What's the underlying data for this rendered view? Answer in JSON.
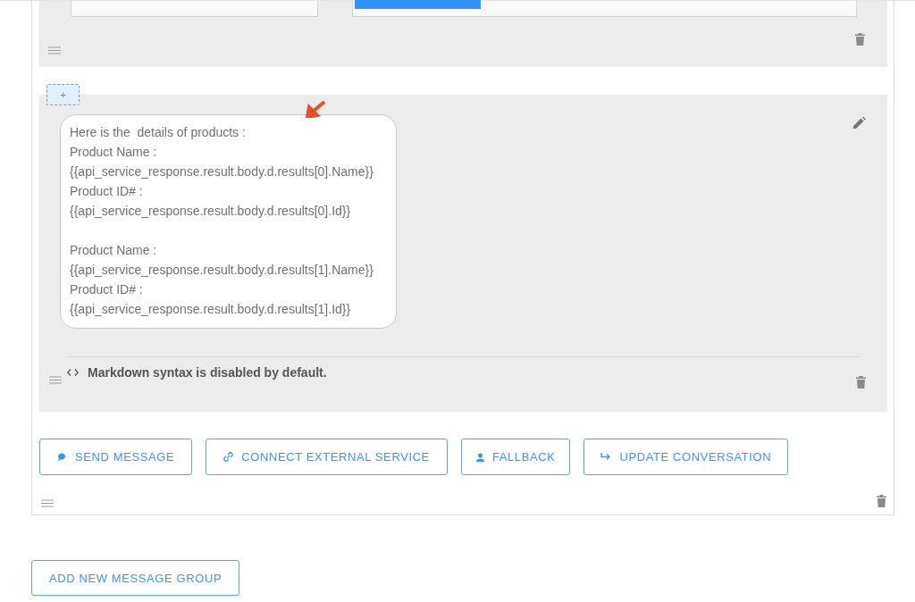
{
  "message_bubble": {
    "blocks": [
      [
        "Here is the  details of products :",
        "Product Name :",
        "{{api_service_response.result.body.d.results[0].Name}}",
        "Product ID# :",
        "{{api_service_response.result.body.d.results[0].Id}}"
      ],
      [
        "Product Name :",
        "{{api_service_response.result.body.d.results[1].Name}}",
        "Product ID# :",
        "{{api_service_response.result.body.d.results[1].Id}}"
      ]
    ]
  },
  "markdown_note": "Markdown syntax is disabled by default.",
  "add_button": "+",
  "actions": [
    {
      "kind": "message",
      "label": "SEND MESSAGE"
    },
    {
      "kind": "link",
      "label": "CONNECT EXTERNAL SERVICE"
    },
    {
      "kind": "person",
      "label": "FALLBACK"
    },
    {
      "kind": "redirect",
      "label": "UPDATE CONVERSATION"
    }
  ],
  "add_group_button": "ADD NEW MESSAGE GROUP"
}
